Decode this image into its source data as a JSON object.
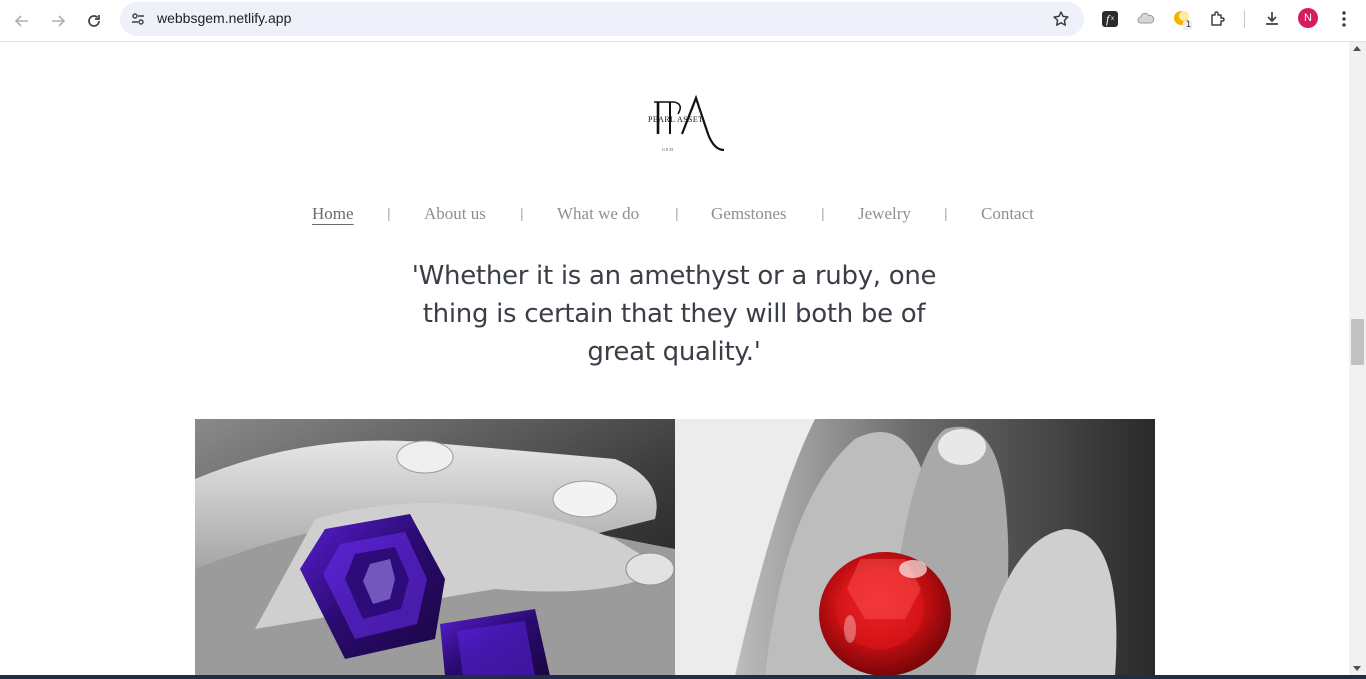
{
  "browser": {
    "url": "webbsgem.netlify.app",
    "extension_badge": "1",
    "profile_initial": "N",
    "icons": [
      "back-icon",
      "forward-icon",
      "reload-icon",
      "site-info-icon",
      "bookmark-star-icon",
      "extension-f-icon",
      "extension-cloud-icon",
      "extension-moon-icon",
      "extensions-puzzle-icon",
      "download-icon",
      "menu-kebab-icon"
    ]
  },
  "site": {
    "logo_text": "PEARL ASSET",
    "logo_subtext": "GEM",
    "nav": [
      {
        "label": "Home",
        "active": true
      },
      {
        "label": "About us",
        "active": false
      },
      {
        "label": "What we do",
        "active": false
      },
      {
        "label": "Gemstones",
        "active": false
      },
      {
        "label": "Jewelry",
        "active": false
      },
      {
        "label": "Contact",
        "active": false
      }
    ],
    "nav_separator": "|",
    "quote_lines": [
      "'Whether it is an amethyst or a ruby, one",
      "thing is certain that they will both be of",
      "great quality.'"
    ],
    "images": [
      {
        "name": "amethyst-photo",
        "subject": "hand holding purple amethyst gemstones"
      },
      {
        "name": "ruby-photo",
        "subject": "fingers holding oval red ruby"
      }
    ]
  },
  "colors": {
    "omnibox_bg": "#eef1f9",
    "nav_text": "#8f8f8f",
    "quote_text": "#3a3f47",
    "avatar": "#d81b60",
    "bottom_bar": "#1f2d4a"
  }
}
